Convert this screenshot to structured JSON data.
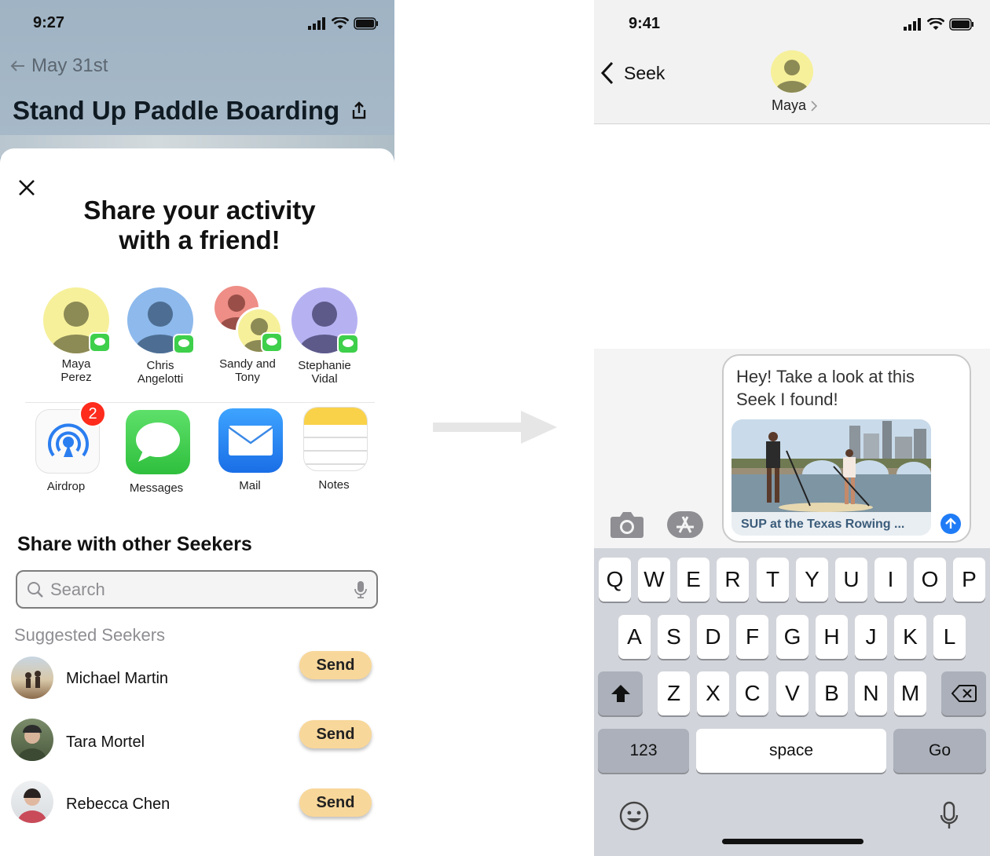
{
  "left": {
    "status_time": "9:27",
    "back_label": "May 31st",
    "page_title": "Stand Up Paddle Boarding",
    "sheet_title_line1": "Share your activity",
    "sheet_title_line2": "with a friend!",
    "contacts": [
      {
        "first": "Maya",
        "last": "Perez"
      },
      {
        "first": "Chris",
        "last": "Angelotti"
      },
      {
        "first": "Sandy and",
        "last": "Tony"
      },
      {
        "first": "Stephanie",
        "last": "Vidal"
      }
    ],
    "apps": [
      {
        "label": "Airdrop",
        "badge": "2"
      },
      {
        "label": "Messages"
      },
      {
        "label": "Mail"
      },
      {
        "label": "Notes"
      }
    ],
    "share_section_title": "Share with other Seekers",
    "search_placeholder": "Search",
    "suggested_label": "Suggested Seekers",
    "seekers": [
      {
        "name": "Michael Martin",
        "action": "Send"
      },
      {
        "name": "Tara Mortel",
        "action": "Send"
      },
      {
        "name": "Rebecca Chen",
        "action": "Send"
      }
    ],
    "colors": {
      "send_button": "#f8d79a",
      "message_badge": "#3ecf4b",
      "airdrop_badge": "#ff2b1c"
    }
  },
  "right": {
    "status_time": "9:41",
    "back_label": "Seek",
    "contact_name": "Maya",
    "message_text": "Hey! Take a look at this Seek I found!",
    "link_caption": "SUP at the Texas Rowing ...",
    "keyboard": {
      "row1": [
        "Q",
        "W",
        "E",
        "R",
        "T",
        "Y",
        "U",
        "I",
        "O",
        "P"
      ],
      "row2": [
        "A",
        "S",
        "D",
        "F",
        "G",
        "H",
        "J",
        "K",
        "L"
      ],
      "row3": [
        "Z",
        "X",
        "C",
        "V",
        "B",
        "N",
        "M"
      ],
      "numbers_key": "123",
      "space_key": "space",
      "go_key": "Go"
    },
    "colors": {
      "send_arrow": "#1f7cf6",
      "keyboard_bg": "#d1d4da"
    }
  }
}
